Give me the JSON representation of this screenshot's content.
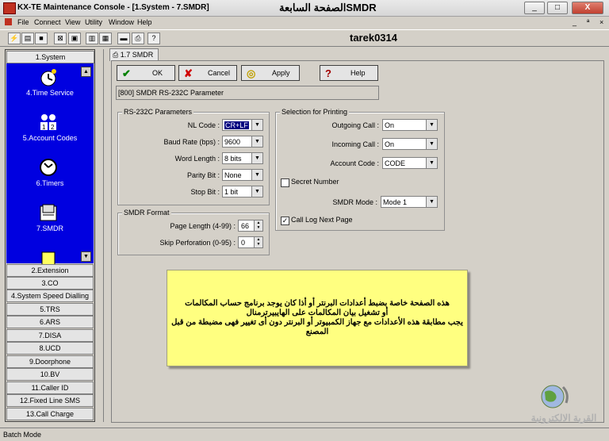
{
  "window": {
    "title": "KX-TE Maintenance Console - [1.System - 7.SMDR]",
    "overlay_title": "الصفحة السابعةSMDR",
    "controls": [
      "_",
      "□",
      "X"
    ],
    "mdi_controls": [
      "_",
      "ª",
      "×"
    ]
  },
  "menu": [
    "File",
    "Connect",
    "View",
    "Utility",
    "Window",
    "Help"
  ],
  "toolbar_user": "tarek0314",
  "nav": {
    "system": "1.System",
    "blue_items": [
      {
        "label": "4.Time Service",
        "icon": "clock-icon"
      },
      {
        "label": "5.Account Codes",
        "icon": "people-icon"
      },
      {
        "label": "6.Timers",
        "icon": "timer-icon"
      },
      {
        "label": "7.SMDR",
        "icon": "printer-icon"
      }
    ],
    "buttons": [
      "2.Extension",
      "3.CO",
      "4.System Speed Dialling",
      "5.TRS",
      "6.ARS",
      "7.DISA",
      "8.UCD",
      "9.Doorphone",
      "10.BV",
      "11.Caller ID",
      "12.Fixed Line SMS",
      "13.Call Charge"
    ]
  },
  "tab_label": "1.7 SMDR",
  "buttons": {
    "ok": "OK",
    "cancel": "Cancel",
    "apply": "Apply",
    "help": "Help"
  },
  "param_title": "[800] SMDR RS-232C Parameter",
  "rs232": {
    "title": "RS-232C Parameters",
    "nl_code_label": "NL Code :",
    "nl_code": "CR+LF",
    "baud_label": "Baud Rate (bps) :",
    "baud": "9600",
    "word_label": "Word Length :",
    "word": "8 bits",
    "parity_label": "Parity Bit :",
    "parity": "None",
    "stop_label": "Stop Bit :",
    "stop": "1 bit"
  },
  "smdr_format": {
    "title": "SMDR Format",
    "page_length_label": "Page Length (4-99) :",
    "page_length": "66",
    "skip_label": "Skip Perforation (0-95) :",
    "skip": "0"
  },
  "printing": {
    "title": "Selection for Printing",
    "outgoing_label": "Outgoing Call :",
    "outgoing": "On",
    "incoming_label": "Incoming Call :",
    "incoming": "On",
    "account_label": "Account Code :",
    "account": "CODE",
    "secret_label": "Secret Number",
    "secret_checked": false,
    "mode_label": "SMDR Mode :",
    "mode": "Mode 1",
    "calllog_label": "Call Log Next Page",
    "calllog_checked": true
  },
  "note": {
    "line1": "هذه الصفحة خاصة بضبط أعدادات البرنتر أو أذا كان يوجد برنامج حساب المكالمات",
    "line2": "أو تشغيل بيان المكالمات على الهايبيرترمنال",
    "line3": "يجب مطابقة هذه الأعدادات مع جهاز الكمبيوتر أو البرنتر دون أى تغيير فهى مضبطة من قبل",
    "line4": "المصنع"
  },
  "watermark_text": "القرية الالكترونية",
  "status": "Batch Mode",
  "colors": {
    "nav_blue": "#0000e0",
    "note_bg": "#ffff80"
  }
}
